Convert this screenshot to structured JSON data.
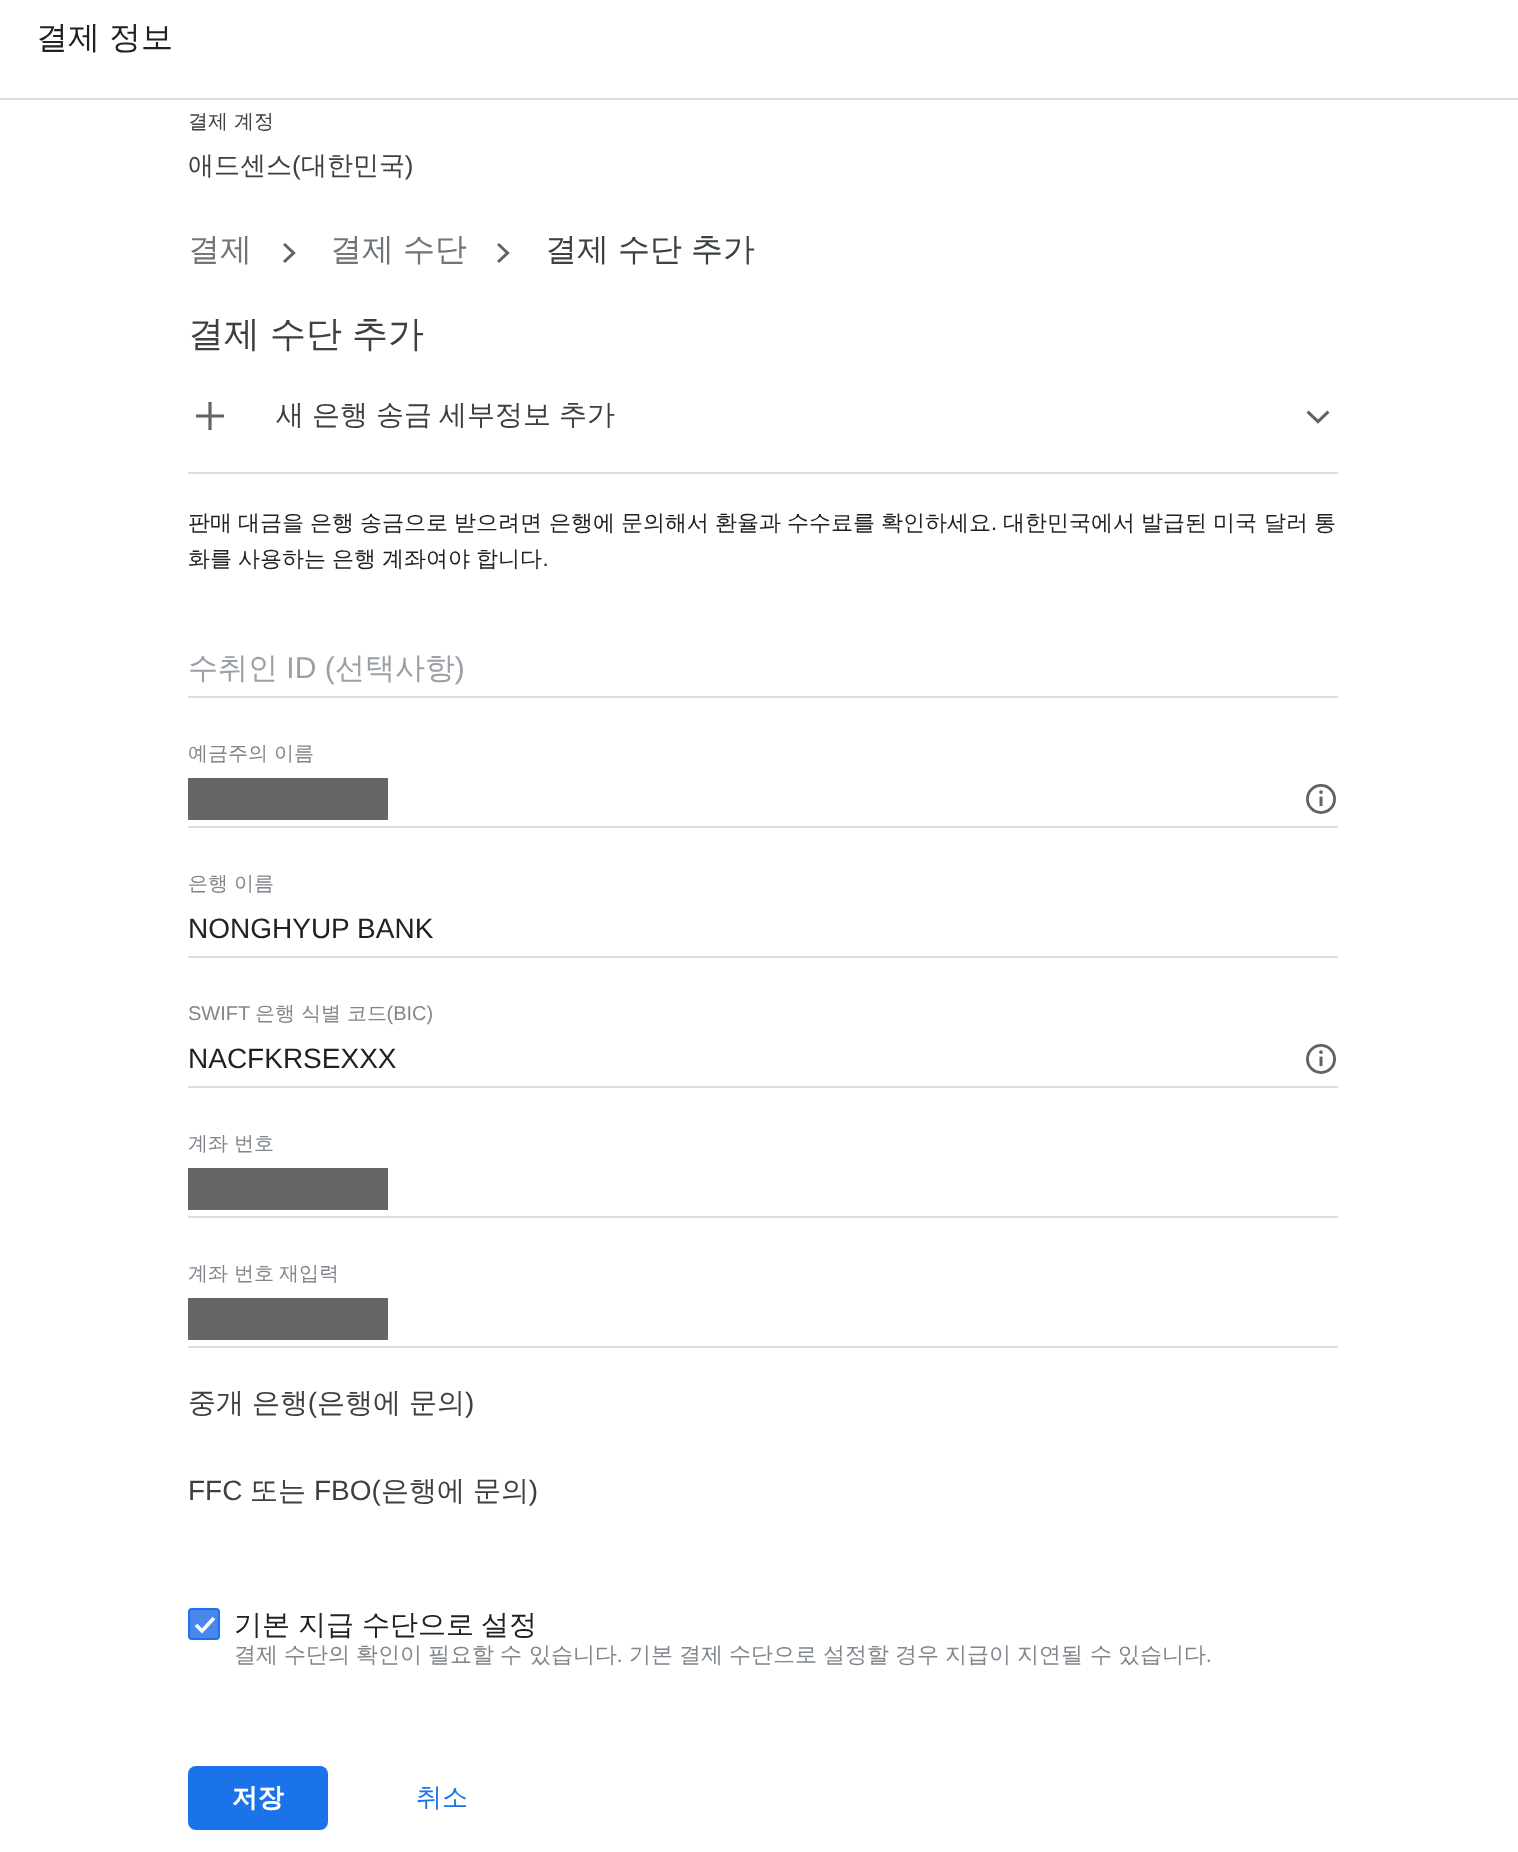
{
  "header": {
    "title": "결제 정보"
  },
  "account": {
    "label": "결제 계정",
    "value": "애드센스(대한민국)"
  },
  "breadcrumbs": [
    {
      "label": "결제",
      "current": false
    },
    {
      "label": "결제 수단",
      "current": false
    },
    {
      "label": "결제 수단 추가",
      "current": true
    }
  ],
  "heading": "결제 수단 추가",
  "add_section": {
    "label": "새 은행 송금 세부정보 추가"
  },
  "notice": "판매 대금을 은행 송금으로 받으려면 은행에 문의해서 환율과 수수료를 확인하세요. 대한민국에서 발급된 미국 달러 통화를 사용하는 은행 계좌여야 합니다.",
  "fields": [
    {
      "kind": "placeholder",
      "placeholder": "수취인 ID (선택사항)",
      "info_icon": false
    },
    {
      "kind": "redacted",
      "label": "예금주의 이름",
      "info_icon": true
    },
    {
      "kind": "text",
      "label": "은행 이름",
      "value": "NONGHYUP BANK",
      "info_icon": false
    },
    {
      "kind": "text",
      "label": "SWIFT 은행 식별 코드(BIC)",
      "value": "NACFKRSEXXX",
      "info_icon": true
    },
    {
      "kind": "redacted",
      "label": "계좌 번호",
      "info_icon": false
    },
    {
      "kind": "redacted",
      "label": "계좌 번호 재입력",
      "info_icon": false
    }
  ],
  "optional_sections": [
    "중개 은행(은행에 문의)",
    "FFC 또는 FBO(은행에 문의)"
  ],
  "default_checkbox": {
    "label": "기본 지급 수단으로 설정",
    "checked": true,
    "hint": "결제 수단의 확인이 필요할 수 있습니다. 기본 결제 수단으로 설정할 경우 지급이 지연될 수 있습니다."
  },
  "buttons": [
    {
      "kind": "primary",
      "label": "저장"
    },
    {
      "kind": "text",
      "label": "취소"
    }
  ]
}
